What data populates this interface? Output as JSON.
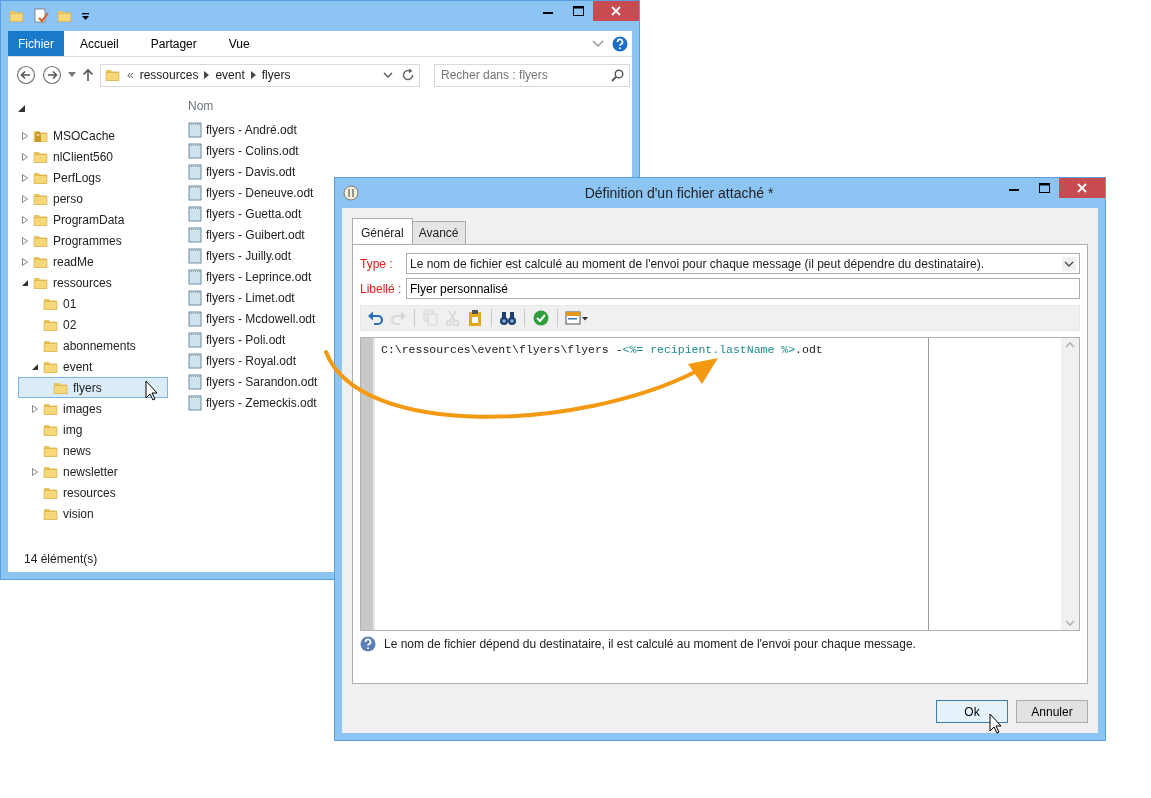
{
  "explorer": {
    "ribbon": {
      "file_tab": "Fichier",
      "tabs": [
        "Accueil",
        "Partager",
        "Vue"
      ]
    },
    "address": {
      "overflow": "«",
      "crumbs": [
        "ressources",
        "event",
        "flyers"
      ]
    },
    "search": {
      "placeholder": "Recher dans : flyers"
    },
    "column": "Nom",
    "tree": [
      {
        "label": "MSOCache",
        "expandable": true,
        "expanded": false,
        "locked": true,
        "selected": false
      },
      {
        "label": "nlClient560",
        "expandable": true,
        "expanded": false,
        "locked": false,
        "selected": false
      },
      {
        "label": "PerfLogs",
        "expandable": true,
        "expanded": false,
        "locked": false,
        "selected": false
      },
      {
        "label": "perso",
        "expandable": true,
        "expanded": false,
        "locked": false,
        "selected": false
      },
      {
        "label": "ProgramData",
        "expandable": true,
        "expanded": false,
        "locked": false,
        "selected": false
      },
      {
        "label": "Programmes",
        "expandable": true,
        "expanded": false,
        "locked": false,
        "selected": false
      },
      {
        "label": "readMe",
        "expandable": true,
        "expanded": false,
        "locked": false,
        "selected": false
      },
      {
        "label": "ressources",
        "expandable": true,
        "expanded": true,
        "locked": false,
        "selected": false,
        "children": [
          {
            "label": "01",
            "expandable": false,
            "locked": false,
            "selected": false
          },
          {
            "label": "02",
            "expandable": false,
            "locked": false,
            "selected": false
          },
          {
            "label": "abonnements",
            "expandable": false,
            "locked": false,
            "selected": false
          },
          {
            "label": "event",
            "expandable": true,
            "expanded": true,
            "locked": false,
            "selected": false,
            "children": [
              {
                "label": "flyers",
                "expandable": false,
                "locked": false,
                "selected": true
              }
            ]
          },
          {
            "label": "images",
            "expandable": true,
            "expanded": false,
            "locked": false,
            "selected": false
          },
          {
            "label": "img",
            "expandable": false,
            "locked": false,
            "selected": false
          },
          {
            "label": "news",
            "expandable": false,
            "locked": false,
            "selected": false
          },
          {
            "label": "newsletter",
            "expandable": true,
            "expanded": false,
            "locked": false,
            "selected": false
          },
          {
            "label": "resources",
            "expandable": false,
            "locked": false,
            "selected": false
          },
          {
            "label": "vision",
            "expandable": false,
            "locked": false,
            "selected": false
          }
        ]
      }
    ],
    "files": [
      "flyers - André.odt",
      "flyers - Colins.odt",
      "flyers - Davis.odt",
      "flyers - Deneuve.odt",
      "flyers - Guetta.odt",
      "flyers - Guibert.odt",
      "flyers - Juilly.odt",
      "flyers - Leprince.odt",
      "flyers - Limet.odt",
      "flyers - Mcdowell.odt",
      "flyers - Poli.odt",
      "flyers - Royal.odt",
      "flyers - Sarandon.odt",
      "flyers - Zemeckis.odt"
    ],
    "status_bar": "14 élément(s)"
  },
  "dialog": {
    "title": "Définition d'un fichier attaché *",
    "tabs": [
      {
        "label": "Général",
        "selected": true
      },
      {
        "label": "Avancé",
        "selected": false
      }
    ],
    "type": {
      "label": "Type :",
      "value": "Le nom de fichier est calculé au moment de l'envoi pour chaque message (il peut dépendre du destinataire)."
    },
    "libelle": {
      "label": "Libellé :",
      "value": "Flyer personnalisé"
    },
    "toolbar": [
      {
        "kind": "undo",
        "disabled": false
      },
      {
        "kind": "redo",
        "disabled": true
      },
      {
        "kind": "separator"
      },
      {
        "kind": "copy",
        "disabled": true
      },
      {
        "kind": "cut",
        "disabled": true
      },
      {
        "kind": "paste",
        "disabled": false
      },
      {
        "kind": "separator"
      },
      {
        "kind": "find",
        "disabled": false
      },
      {
        "kind": "separator"
      },
      {
        "kind": "check",
        "disabled": false
      },
      {
        "kind": "separator"
      },
      {
        "kind": "insert",
        "disabled": false
      }
    ],
    "code": [
      {
        "kind": "text",
        "text": "C:\\ressources\\event\\flyers\\flyers -"
      },
      {
        "kind": "tag",
        "text": "<%= recipient.lastName %>"
      },
      {
        "kind": "text",
        "text": ".odt"
      }
    ],
    "help": "Le nom de fichier dépend du destinataire, il est calculé au moment de l'envoi pour chaque message.",
    "buttons": [
      {
        "label": "Ok",
        "focused": true
      },
      {
        "label": "Annuler",
        "focused": false
      }
    ]
  }
}
